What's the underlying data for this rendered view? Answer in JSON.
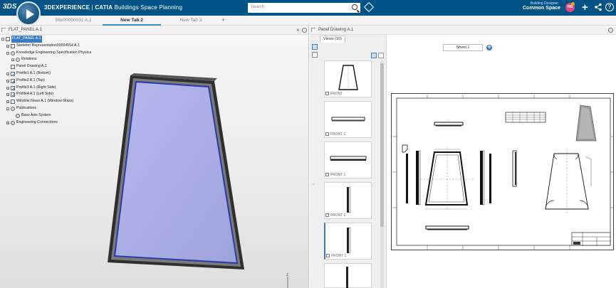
{
  "app": {
    "brand_left": "3DEXPERIENCE",
    "brand_sep": " | ",
    "brand_app": "CATIA",
    "brand_module": "Buildings Space Planning",
    "search_placeholder": "Search",
    "role_line1": "Building Designer",
    "role_line2": "Common Space",
    "accent": "#005386",
    "tag_icon": "tag-icon",
    "plus_icon": "plus-icon",
    "share_icon": "share-icon",
    "help_icon": "help-icon",
    "help_glyph": "?"
  },
  "tabs": [
    {
      "label": "Site00000031 A.1",
      "active": false
    },
    {
      "label": "New Tab 2",
      "active": true
    },
    {
      "label": "New Tab 3",
      "active": false
    }
  ],
  "tab_add": "+",
  "left_panel": {
    "title": "FLAT_PANEL A.1",
    "tree": [
      {
        "label": "FLAT_PANEL A.1",
        "indent": 0,
        "selected": true,
        "expander": "-",
        "icon": "part"
      },
      {
        "label": "Skeleton Representation00004554 A.1",
        "indent": 1,
        "expander": "+",
        "icon": "part"
      },
      {
        "label": "Knowledge Engineering Specification Physica",
        "indent": 1,
        "expander": "-",
        "icon": "cog"
      },
      {
        "label": "Relations",
        "indent": 2,
        "expander": "+",
        "icon": "cog"
      },
      {
        "label": "Panel Drawing A.1",
        "indent": 1,
        "expander": "",
        "icon": "part"
      },
      {
        "label": "Profile1 A.1 (Bottom)",
        "indent": 1,
        "expander": "+",
        "icon": "sketch"
      },
      {
        "label": "Profile2 A.1 (Top)",
        "indent": 1,
        "expander": "+",
        "icon": "sketch"
      },
      {
        "label": "Profile3 A.1 (Right Side)",
        "indent": 1,
        "expander": "+",
        "icon": "sketch"
      },
      {
        "label": "Profile4 A.1 (Left Side)",
        "indent": 1,
        "expander": "+",
        "icon": "sketch"
      },
      {
        "label": "Window Glass A.1 (Window Glass)",
        "indent": 1,
        "expander": "+",
        "icon": "part"
      },
      {
        "label": "Publications",
        "indent": 1,
        "expander": "-",
        "icon": "cog"
      },
      {
        "label": "Base Axis System",
        "indent": 2,
        "expander": "",
        "icon": "cog"
      },
      {
        "label": "Engineering Connections",
        "indent": 1,
        "expander": "+",
        "icon": "cog"
      }
    ],
    "axis_labels": {
      "z": "Z",
      "y": "Y",
      "x": "X"
    }
  },
  "drawing_panel": {
    "title": "Panel Drawing A.1",
    "views_tab": "Views (10)",
    "thumbnails": [
      {
        "caption": "FRONT"
      },
      {
        "caption": "FRONT 1"
      },
      {
        "caption": "FRONT 1"
      },
      {
        "caption": "FRONT 1"
      },
      {
        "caption": "FRONT 1"
      }
    ],
    "sheet_label": "Sheet.1"
  },
  "colors": {
    "glass": "#aeb2e6",
    "frame": "#3a3a3a",
    "selection": "#3b7bbf"
  }
}
